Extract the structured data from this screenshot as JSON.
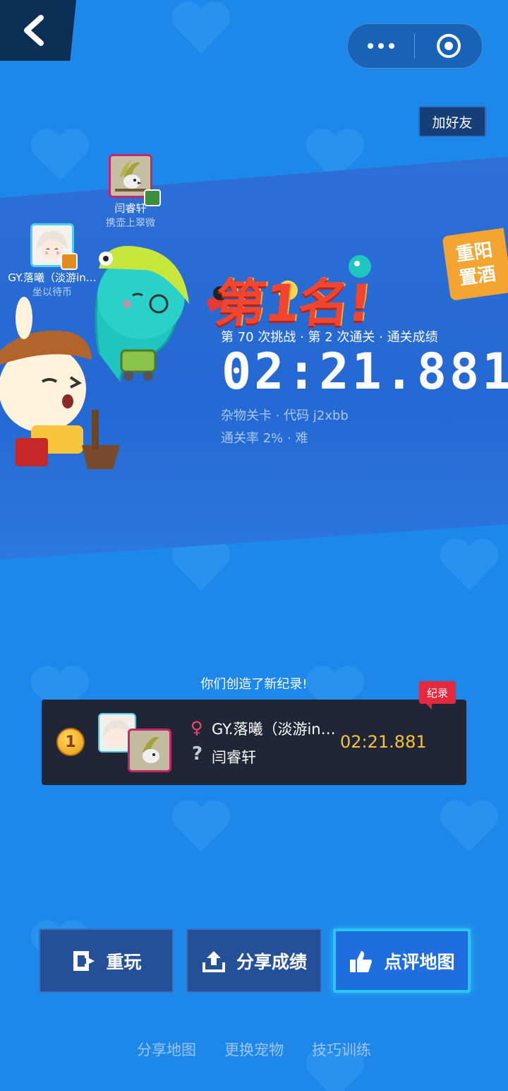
{
  "header": {
    "add_friend_label": "加好友"
  },
  "players": [
    {
      "name": "闫睿轩",
      "title": "携壶上翠微"
    },
    {
      "name": "GY.落曦（淡游in…",
      "title": "坐以待币"
    }
  ],
  "event_tag": {
    "line1": "重阳",
    "line2": "置酒"
  },
  "result": {
    "rank_title": "第1名!",
    "stats_line": "第 70 次挑战 · 第 2 次通关 · 通关成绩",
    "time": "02:21.881",
    "level_info": "杂物关卡 · 代码 j2xbb",
    "pass_rate": "通关率 2% · 难"
  },
  "record": {
    "heading": "你们创造了新纪录!",
    "tag": "纪录",
    "rank": "1",
    "player1": "GY.落曦（淡游in…",
    "player2": "闫睿轩",
    "time": "02:21.881"
  },
  "actions": {
    "replay": "重玩",
    "share_result": "分享成绩",
    "review_map": "点评地图"
  },
  "links": {
    "share_map": "分享地图",
    "change_pet": "更换宠物",
    "skill_training": "技巧训练"
  },
  "colors": {
    "background": "#1e88ea",
    "accent_gold": "#f7c437",
    "rank_red": "#f2452f",
    "record_card": "#212636",
    "record_tag": "#e4293f"
  }
}
